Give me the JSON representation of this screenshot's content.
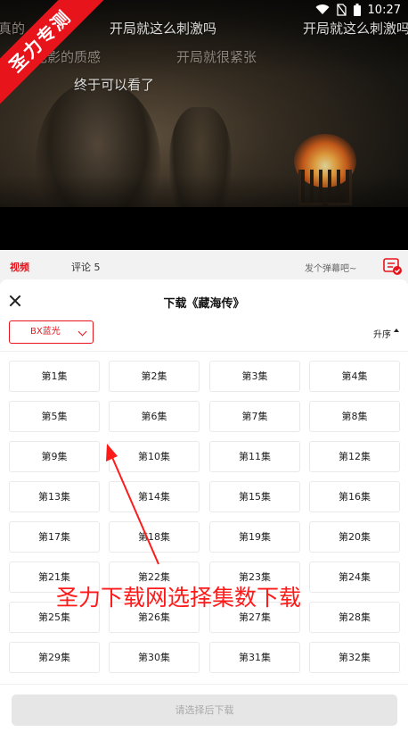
{
  "status_bar": {
    "time": "10:27"
  },
  "watermark": {
    "text": "圣力专测"
  },
  "video": {
    "danmaku": [
      {
        "text": "开局就这么刺激吗"
      },
      {
        "text": "开局就这么刺激吗"
      },
      {
        "text": "真的"
      },
      {
        "text": "电影的质感"
      },
      {
        "text": "开局就很紧张"
      },
      {
        "text": "终于可以看了"
      }
    ]
  },
  "tabs": {
    "video_label": "视频",
    "comment_label": "评论 5",
    "danmu_placeholder": "发个弹幕吧~"
  },
  "panel": {
    "title": "下载《藏海传》",
    "quality": "BX蓝光",
    "sort_label": "升序",
    "episodes": [
      "第1集",
      "第2集",
      "第3集",
      "第4集",
      "第5集",
      "第6集",
      "第7集",
      "第8集",
      "第9集",
      "第10集",
      "第11集",
      "第12集",
      "第13集",
      "第14集",
      "第15集",
      "第16集",
      "第17集",
      "第18集",
      "第19集",
      "第20集",
      "第21集",
      "第22集",
      "第23集",
      "第24集",
      "第25集",
      "第26集",
      "第27集",
      "第28集",
      "第29集",
      "第30集",
      "第31集",
      "第32集"
    ],
    "download_button": "请选择后下载"
  },
  "annotation": {
    "text": "圣力下载网选择集数下载",
    "color": "#ff1a1a"
  },
  "colors": {
    "accent": "#e8141c"
  }
}
